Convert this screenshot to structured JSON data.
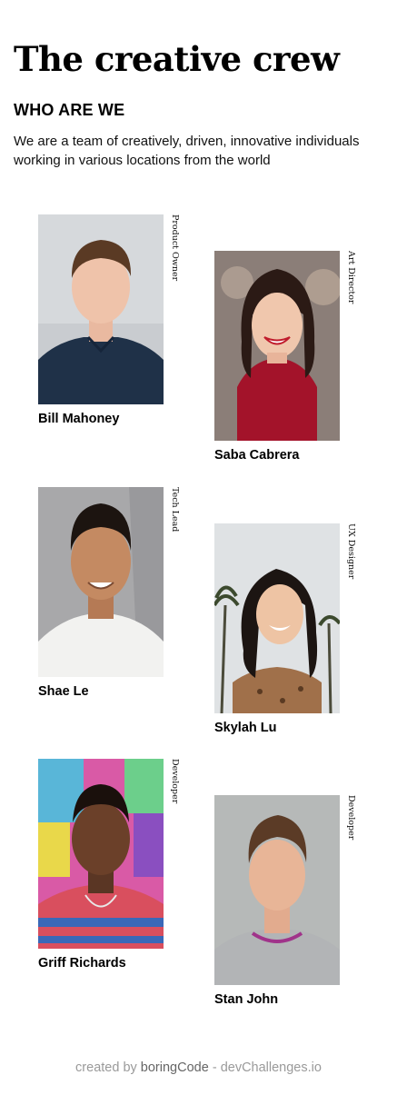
{
  "page": {
    "title": "The creative crew",
    "subtitle": "WHO ARE WE",
    "intro": "We are a team of creatively, driven, innovative individuals working in various locations from the world"
  },
  "team": [
    {
      "name": "Bill Mahoney",
      "role": "Product Owner",
      "photo": "portrait-man-navy-polo"
    },
    {
      "name": "Saba Cabrera",
      "role": "Art Director",
      "photo": "portrait-woman-red-sweater"
    },
    {
      "name": "Shae Le",
      "role": "Tech Lead",
      "photo": "portrait-man-white-tshirt"
    },
    {
      "name": "Skylah Lu",
      "role": "UX Designer",
      "photo": "portrait-woman-palm-trees"
    },
    {
      "name": "Griff Richards",
      "role": "Developer",
      "photo": "portrait-man-graffiti-wall"
    },
    {
      "name": "Stan John",
      "role": "Developer",
      "photo": "portrait-man-grey-sweater"
    }
  ],
  "footer": {
    "prefix": "created by",
    "author": "boringCode",
    "separator": "-",
    "site": "devChallenges.io"
  }
}
